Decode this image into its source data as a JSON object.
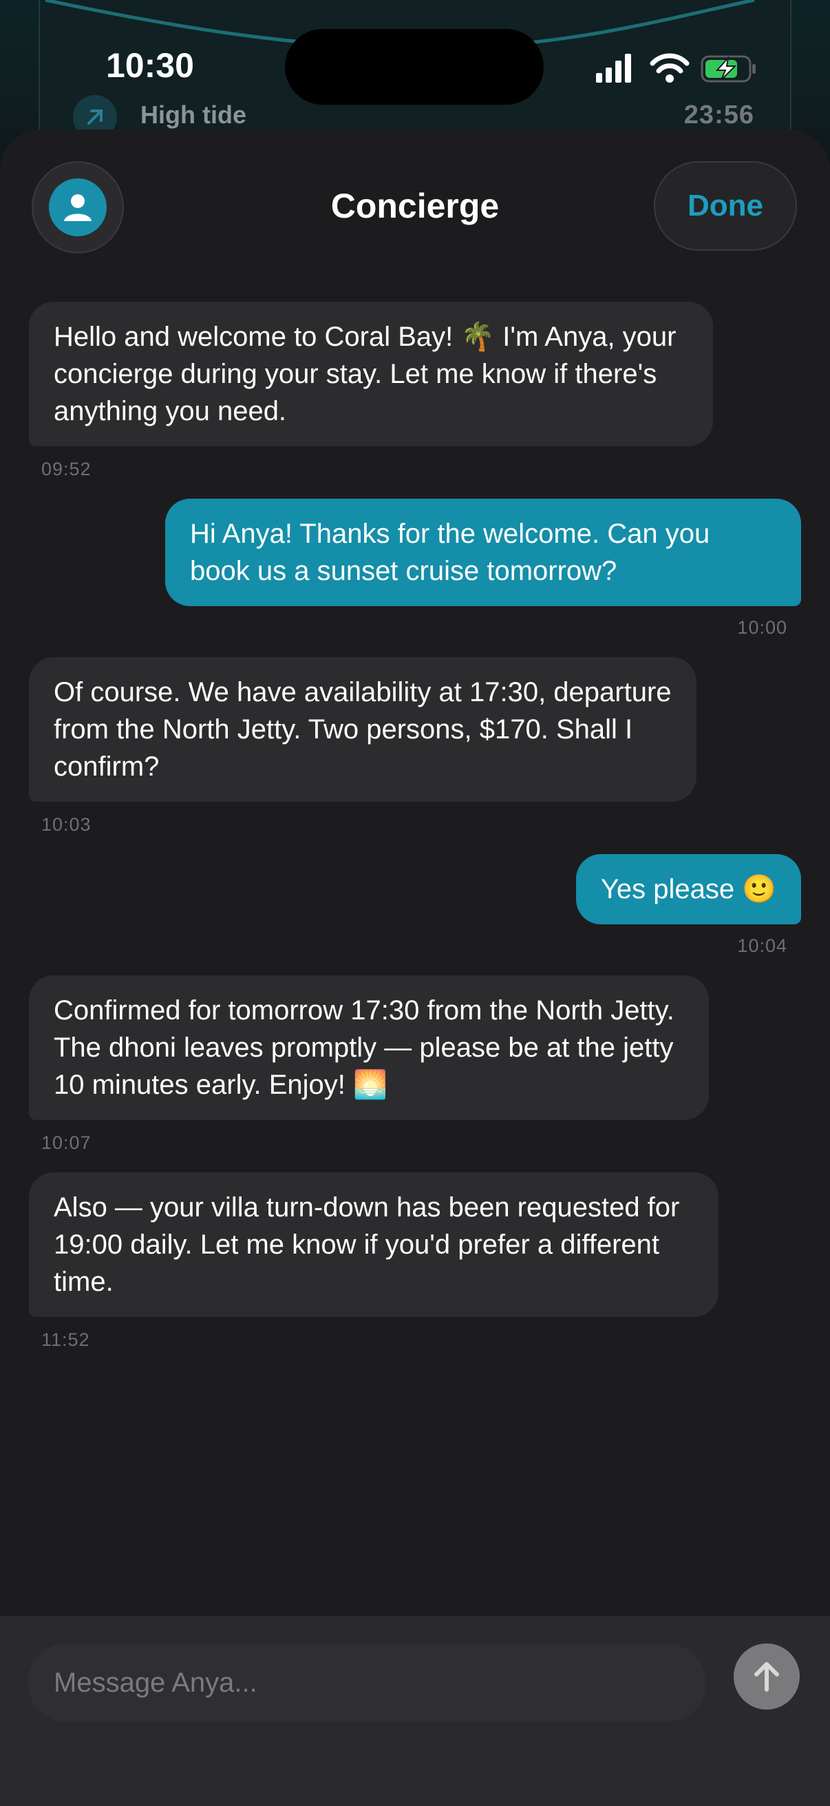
{
  "status_bar": {
    "time": "10:30"
  },
  "background": {
    "tide_label": "High tide",
    "tide_time": "23:56",
    "tide_icon": "arrow-up-right-icon"
  },
  "header": {
    "title": "Concierge",
    "done_label": "Done",
    "avatar_icon": "person-icon"
  },
  "messages": [
    {
      "from": "concierge",
      "text": "Hello and welcome to Coral Bay! 🌴 I'm Anya, your concierge during your stay. Let me know if there's anything you need.",
      "time": "09:52"
    },
    {
      "from": "guest",
      "text": "Hi Anya! Thanks for the welcome. Can you book us a sunset cruise tomorrow?",
      "time": "10:00"
    },
    {
      "from": "concierge",
      "text": "Of course. We have availability at 17:30, departure from the North Jetty. Two persons, $170. Shall I confirm?",
      "time": "10:03"
    },
    {
      "from": "guest",
      "text": "Yes please 🙂",
      "time": "10:04"
    },
    {
      "from": "concierge",
      "text": "Confirmed for tomorrow 17:30 from the North Jetty. The dhoni leaves promptly — please be at the jetty 10 minutes early. Enjoy! 🌅",
      "time": "10:07"
    },
    {
      "from": "concierge",
      "text": "Also — your villa turn-down has been requested for 19:00 daily. Let me know if you'd prefer a different time.",
      "time": "11:52"
    }
  ],
  "composer": {
    "placeholder": "Message Anya...",
    "send_icon": "arrow-up-icon"
  },
  "colors": {
    "accent": "#158ea9",
    "done_text": "#1c9ec0",
    "incoming_bubble": "#2c2c2e",
    "background": "#1c1c1e"
  }
}
